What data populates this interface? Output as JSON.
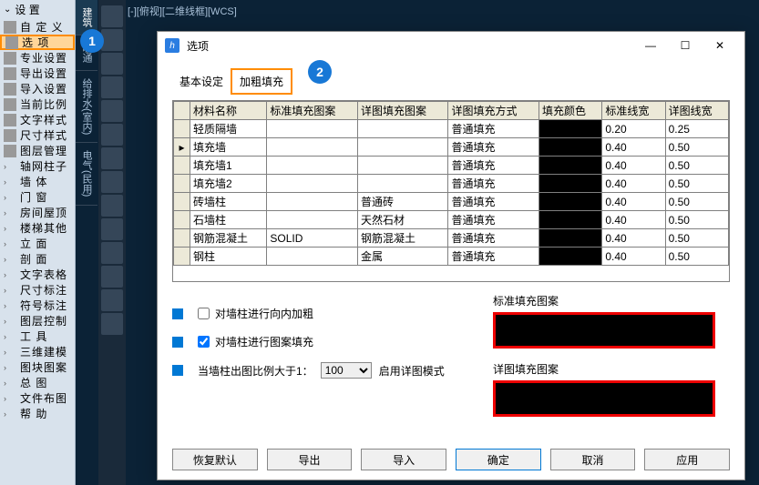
{
  "topbar": "[-][俯视][二维线框][WCS]",
  "sidebar": {
    "header": "设  置",
    "items": [
      {
        "label": "自 定 义"
      },
      {
        "label": "选     项",
        "highlight": true
      },
      {
        "label": "专业设置"
      },
      {
        "label": "导出设置"
      },
      {
        "label": "导入设置"
      },
      {
        "label": "当前比例"
      },
      {
        "label": "文字样式"
      },
      {
        "label": "尺寸样式"
      },
      {
        "label": "图层管理"
      }
    ],
    "groups": [
      {
        "label": "轴网柱子"
      },
      {
        "label": "墙     体"
      },
      {
        "label": "门     窗"
      },
      {
        "label": "房间屋顶"
      },
      {
        "label": "楼梯其他"
      },
      {
        "label": "立     面"
      },
      {
        "label": "剖     面"
      },
      {
        "label": "文字表格"
      },
      {
        "label": "尺寸标注"
      },
      {
        "label": "符号标注"
      },
      {
        "label": "图层控制"
      },
      {
        "label": "工     具"
      },
      {
        "label": "三维建模"
      },
      {
        "label": "图块图案"
      },
      {
        "label": "总     图"
      },
      {
        "label": "文件布图"
      },
      {
        "label": "帮     助"
      }
    ]
  },
  "vtabs": [
    "建筑",
    "暖通",
    "给排水(室内)",
    "电气(民用)"
  ],
  "badges": {
    "one": "1",
    "two": "2"
  },
  "dialog": {
    "title": "选项",
    "tabs": {
      "basic": "基本设定",
      "bold_fill": "加粗填充"
    },
    "table": {
      "headers": [
        "",
        "材料名称",
        "标准填充图案",
        "详图填充图案",
        "详图填充方式",
        "填充颜色",
        "标准线宽",
        "详图线宽"
      ],
      "rows": [
        {
          "name": "轻质隔墙",
          "std": "",
          "det": "",
          "mode": "普通填充",
          "color": "256",
          "w1": "0.20",
          "w2": "0.25"
        },
        {
          "name": "填充墙",
          "std": "",
          "det": "",
          "mode": "普通填充",
          "color": "256",
          "w1": "0.40",
          "w2": "0.50",
          "current": true
        },
        {
          "name": "填充墙1",
          "std": "",
          "det": "",
          "mode": "普通填充",
          "color": "256",
          "w1": "0.40",
          "w2": "0.50"
        },
        {
          "name": "填充墙2",
          "std": "",
          "det": "",
          "mode": "普通填充",
          "color": "256",
          "w1": "0.40",
          "w2": "0.50"
        },
        {
          "name": "砖墙柱",
          "std": "",
          "det": "普通砖",
          "mode": "普通填充",
          "color": "256",
          "w1": "0.40",
          "w2": "0.50"
        },
        {
          "name": "石墙柱",
          "std": "",
          "det": "天然石材",
          "mode": "普通填充",
          "color": "256",
          "w1": "0.40",
          "w2": "0.50"
        },
        {
          "name": "钢筋混凝土",
          "std": "SOLID",
          "det": "钢筋混凝土",
          "mode": "普通填充",
          "color": "256",
          "w1": "0.40",
          "w2": "0.50"
        },
        {
          "name": "钢柱",
          "std": "",
          "det": "金属",
          "mode": "普通填充",
          "color": "256",
          "w1": "0.40",
          "w2": "0.50"
        }
      ]
    },
    "opts": {
      "inner_bold": "对墙柱进行向内加粗",
      "inner_bold_checked": false,
      "pattern_fill": "对墙柱进行图案填充",
      "pattern_fill_checked": true,
      "scale_label_pre": "当墙柱出图比例大于1：",
      "scale_value": "100",
      "scale_label_post": "启用详图模式",
      "std_preview": "标准填充图案",
      "det_preview": "详图填充图案"
    },
    "buttons": {
      "restore": "恢复默认",
      "export": "导出",
      "import": "导入",
      "ok": "确定",
      "cancel": "取消",
      "apply": "应用"
    }
  }
}
